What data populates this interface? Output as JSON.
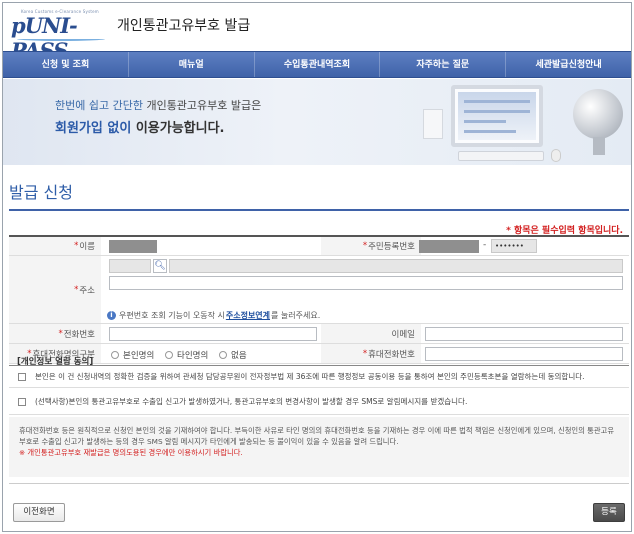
{
  "header": {
    "logo_small": "Korea Customs e-Clearance System",
    "logo_brand": "UNI-PASS",
    "title": "개인통관고유부호 발급"
  },
  "nav": [
    "신청 및 조회",
    "매뉴얼",
    "수입통관내역조회",
    "자주하는 질문",
    "세관발급신청안내"
  ],
  "banner": {
    "line1_a": "한번에 쉽고 간단한",
    "line1_b": " 개인통관고유부호 발급은",
    "line2_a": "회원가입 없이",
    "line2_b": " 이용가능합니다."
  },
  "page_title": "발급 신청",
  "required_note": "* 항목은 필수입력 항목입니다.",
  "form": {
    "name_label": "이름",
    "rrn_label": "주민등록번호",
    "rrn_dash": "-",
    "rrn_back": "•••••••",
    "address_label": "주소",
    "search_icon": "magnifier-icon",
    "address_hint_a": "우편번호 조회 기능이 오동작 시 ",
    "address_hint_link": "주소정보연계",
    "address_hint_b": "를 눌러주세요.",
    "phone_label": "전화번호",
    "email_label": "이메일",
    "mobile_type_label": "휴대전화명의구분",
    "mobile_type_options": [
      "본인명의",
      "타인명의",
      "없음"
    ],
    "mobile_label": "휴대전화번호"
  },
  "consent": {
    "title": "[개인정보 열람 동의]",
    "item1": "본인은 이 건 신청내역의 정확한 검증을 위하여 관세청 담당공무원이 전자정부법 제 36조에 따른 행정정보 공동이용 등을 통하여 본인의 주민등록초본을 열람하는데 동의합니다.",
    "item2": "(선택사항)본인의 통관고유부호로 수출입 신고가 발생하였거나, 통관고유부호의 변경사항이 발생할 경우 SMS로 알림메시지를 받겠습니다.",
    "notice1": "휴대전화번호 등은 원칙적으로 신청인 본인의 것을 기재하여야 합니다. 부득이한 사유로 타인 명의의 휴대전화번호 등을 기재하는 경우 이에 따른 법적 책임은 신청인에게 있으며, 신청인의 통관고유부호로 수출입 신고가 발생하는 등의 경우 SMS 알림 메시지가 타인에게 발송되는 등 불이익이 있을 수 있음을 알려 드립니다.",
    "notice_warn": "※ 개인통관고유부호 재발급은 명의도용된 경우에만 이용하시기 바랍니다."
  },
  "buttons": {
    "prev": "이전화면",
    "register": "등록"
  },
  "colors": {
    "nav": "#4a6cb3",
    "title": "#2f5ea8",
    "required": "#d32020"
  }
}
